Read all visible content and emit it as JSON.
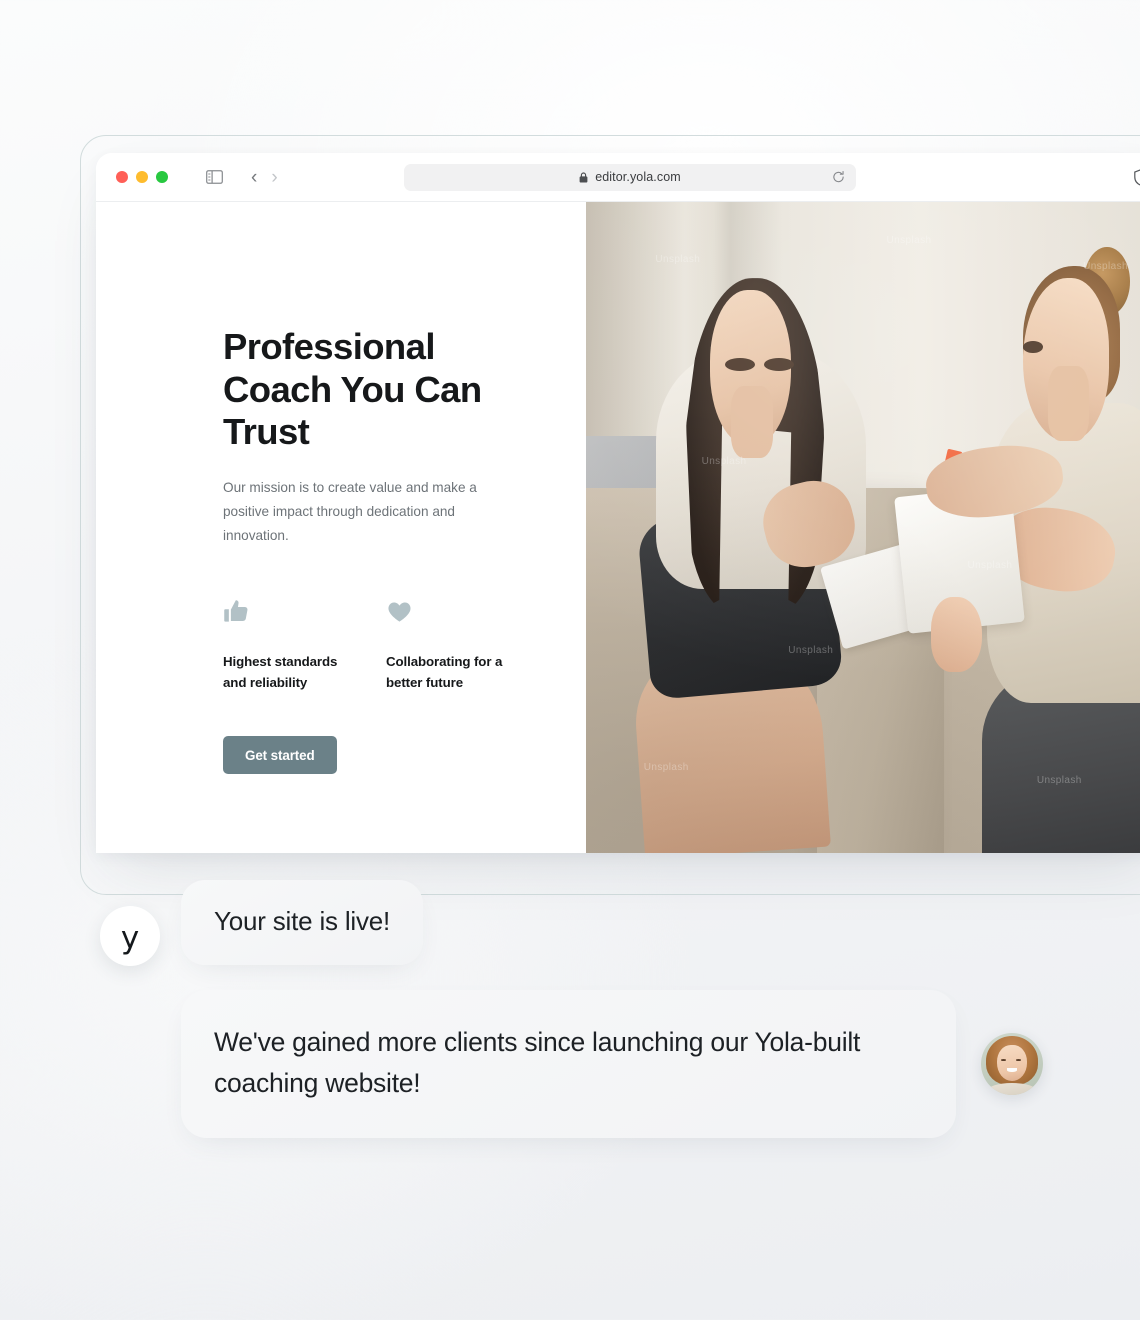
{
  "browser": {
    "url": "editor.yola.com",
    "lock_icon": "lock-icon",
    "reload_icon": "reload-icon",
    "shield_icon": "shield-icon",
    "sidebar_icon": "sidebar-toggle-icon",
    "back_icon": "chevron-left-icon",
    "forward_icon": "chevron-right-icon",
    "back_glyph": "‹",
    "forward_glyph": "›",
    "traffic_lights": [
      "close",
      "minimize",
      "zoom"
    ],
    "colors": {
      "close": "#ff5f57",
      "minimize": "#febc2e",
      "zoom": "#28c840",
      "url_bar_bg": "#f1f1f2"
    }
  },
  "site": {
    "hero": {
      "title": "Professional Coach You Can Trust",
      "subtitle": "Our mission is to create value and make a positive impact through dedication and innovation.",
      "cta_label": "Get started",
      "cta_color": "#6b8188",
      "features": [
        {
          "icon": "thumbs-up-icon",
          "text": "Highest standards and reliability"
        },
        {
          "icon": "heart-icon",
          "text": "Collaborating for a better future"
        }
      ],
      "icon_color": "#b2c1c6",
      "photo_alt": "Two women sitting on a sofa during a coaching session with notebooks",
      "photo_watermarks": [
        "Unsplash",
        "Unsplash",
        "Unsplash",
        "Unsplash",
        "Unsplash",
        "Unsplash",
        "Unsplash",
        "Unsplash"
      ]
    }
  },
  "chat": {
    "messages": [
      {
        "avatar": "yola-logo-avatar",
        "avatar_glyph": "y",
        "text": "Your site is live!"
      },
      {
        "avatar": "client-photo-avatar",
        "text": "We've gained more clients since launching our Yola-built coaching website!"
      }
    ]
  }
}
